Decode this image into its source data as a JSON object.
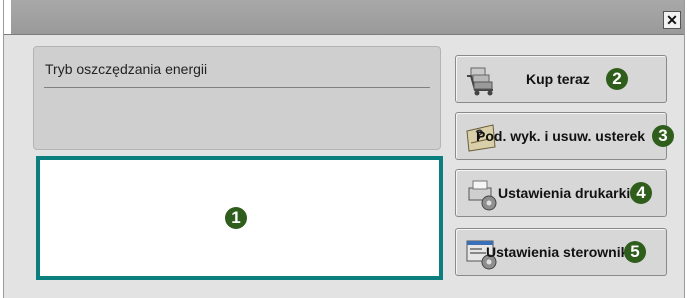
{
  "window": {
    "close_glyph": "✕"
  },
  "panel": {
    "title": "Tryb oszczędzania energii"
  },
  "callouts": [
    "1",
    "2",
    "3",
    "4",
    "5"
  ],
  "buttons": [
    {
      "label": "Kup teraz",
      "icon": "cart-icon"
    },
    {
      "label": "Pod. wyk. i usuw. usterek",
      "icon": "troubleshooting-icon"
    },
    {
      "label": "Ustawienia drukarki",
      "icon": "printer-settings-icon"
    },
    {
      "label": "Ustawienia sterownika",
      "icon": "driver-settings-icon"
    }
  ],
  "colors": {
    "callout": "#2f5d1c",
    "highlight_border": "#0b7f7e"
  }
}
